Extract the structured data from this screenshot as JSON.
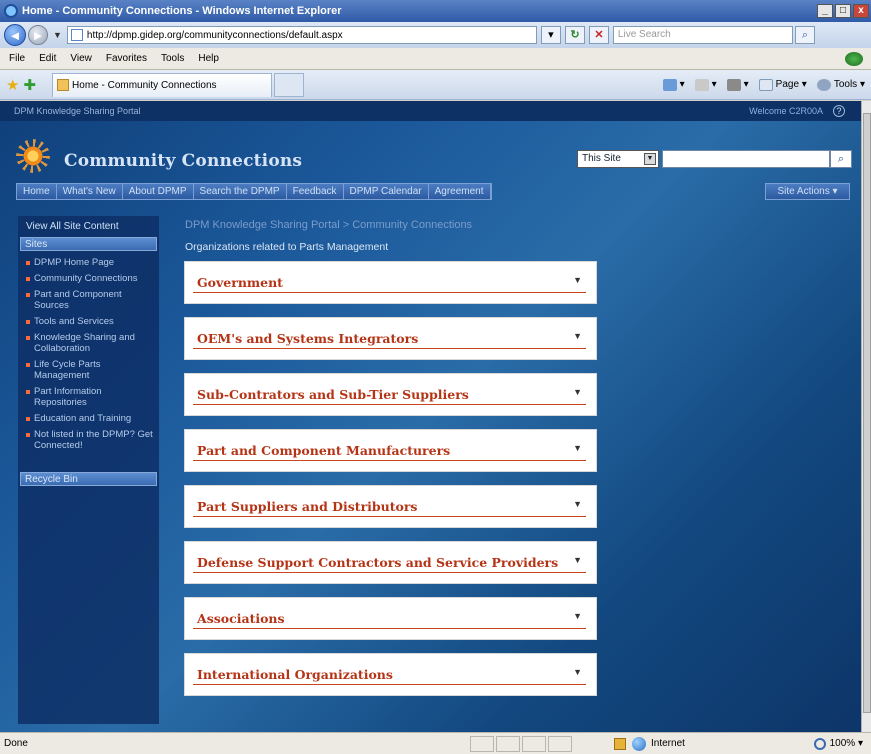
{
  "window": {
    "title": "Home - Community Connections - Windows Internet Explorer",
    "minimize": "_",
    "maximize": "□",
    "close": "x"
  },
  "browser": {
    "url": "http://dpmp.gidep.org/communityconnections/default.aspx",
    "search_placeholder": "Live Search",
    "menu": [
      "File",
      "Edit",
      "View",
      "Favorites",
      "Tools",
      "Help"
    ],
    "tab_label": "Home - Community Connections",
    "commands": {
      "page": "Page",
      "tools": "Tools"
    }
  },
  "site": {
    "portal_name": "DPM Knowledge Sharing Portal",
    "welcome": "Welcome C2R00A",
    "title": "Community Connections",
    "scope": "This Site",
    "top_nav": [
      "Home",
      "What's New",
      "About DPMP",
      "Search the DPMP",
      "Feedback",
      "DPMP Calendar",
      "Agreement"
    ],
    "site_actions": "Site Actions"
  },
  "quick_launch": {
    "view_all": "View All Site Content",
    "sites_header": "Sites",
    "items": [
      "DPMP Home Page",
      "Community Connections",
      "Part and Component Sources",
      "Tools and Services",
      "Knowledge Sharing and Collaboration",
      "Life Cycle Parts Management",
      "Part Information Repositories",
      "Education and Training",
      "Not listed in the DPMP? Get Connected!"
    ],
    "recycle_bin": "Recycle Bin"
  },
  "main": {
    "breadcrumb": "DPM Knowledge Sharing Portal > Community Connections",
    "heading": "Organizations related to Parts Management",
    "panels": [
      "Government",
      "OEM's and Systems Integrators",
      "Sub-Contrators and Sub-Tier Suppliers",
      "Part and Component Manufacturers",
      "Part Suppliers and Distributors",
      "Defense Support Contractors and Service Providers",
      "Associations",
      "International Organizations"
    ]
  },
  "status": {
    "text": "Done",
    "zone": "Internet",
    "zoom": "100%"
  }
}
